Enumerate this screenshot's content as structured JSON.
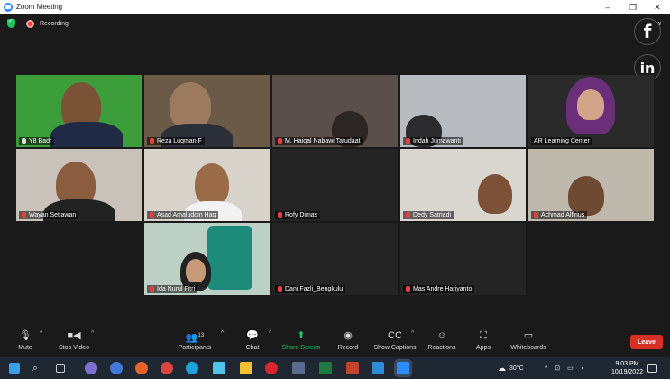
{
  "window": {
    "title": "Zoom Meeting",
    "controls": {
      "minimize": "–",
      "restore": "❐",
      "close": "✕"
    }
  },
  "meeting": {
    "recording_label": "Recording",
    "view_label": "View"
  },
  "social": {
    "facebook": "f",
    "linkedin": "in"
  },
  "participants": [
    {
      "name": "Y8 Badr",
      "muted": false,
      "bg": "#3c9e3a"
    },
    {
      "name": "Reza Luqman F",
      "muted": true,
      "bg": "#6b5a48"
    },
    {
      "name": "M. Haiqal Nabawi Tatudaat",
      "muted": true,
      "bg": "#5a4f4a"
    },
    {
      "name": "Indah Jumawanti",
      "muted": true,
      "bg": "#9ea4aa"
    },
    {
      "name": "AR Learning Center",
      "muted": false,
      "bg": "#2a2a2a"
    },
    {
      "name": "Wayan Setiawan",
      "muted": true,
      "bg": "#c8c2ba"
    },
    {
      "name": "Asad Amaluddin Haq",
      "muted": true,
      "bg": "#d7d2ca"
    },
    {
      "name": "Rofy Dimas",
      "muted": true,
      "bg": "#242424"
    },
    {
      "name": "Dedy Satriadi",
      "muted": true,
      "bg": "#d9d6d0"
    },
    {
      "name": "Achmad Alfirius",
      "muted": true,
      "bg": "#bfb8ad"
    },
    {
      "name": "Ida Nurul Fitri",
      "muted": true,
      "bg": "#bcd0c5"
    },
    {
      "name": "Dani Fazli_Bengkulu",
      "muted": true,
      "bg": "#242424"
    },
    {
      "name": "Mas Andre Hariyanto",
      "muted": true,
      "bg": "#242424"
    }
  ],
  "toolbar": {
    "mute": "Mute",
    "stop_video": "Stop Video",
    "participants": "Participants",
    "participant_count": "13",
    "chat": "Chat",
    "share_screen": "Share Screen",
    "record": "Record",
    "show_captions": "Show Captions",
    "reactions": "Reactions",
    "apps": "Apps",
    "whiteboards": "Whiteboards",
    "leave": "Leave"
  },
  "taskbar": {
    "weather": "30°C",
    "time": "9:03 PM",
    "date": "10/19/2022"
  },
  "colors": {
    "share_green": "#22c55e",
    "leave_red": "#d93025",
    "active_speaker": "#d4e157"
  }
}
